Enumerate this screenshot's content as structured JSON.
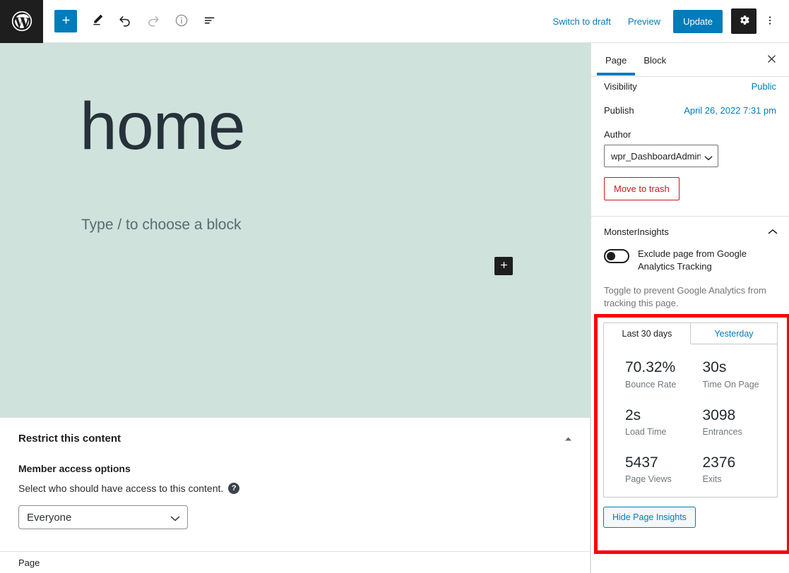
{
  "toolbar": {
    "logo_icon": "wordpress-logo-icon",
    "add_block_label": "+",
    "add_block_icon": "plus-icon",
    "edit_icon": "pencil-icon",
    "undo_icon": "undo-arrow-icon",
    "redo_icon": "redo-arrow-icon",
    "details_icon": "info-circle-icon",
    "list_view_icon": "list-view-icon",
    "switch_to_draft_label": "Switch to draft",
    "preview_label": "Preview",
    "update_label": "Update",
    "settings_icon": "gear-icon",
    "more_options_icon": "three-dots-vertical-icon",
    "accent_color": "#007cba",
    "dark_color": "#1e1e1e"
  },
  "canvas": {
    "post_title": "home",
    "block_placeholder": "Type / to choose a block",
    "inline_adder_label": "+",
    "inline_adder_icon": "plus-icon",
    "background_color": "#cfe2dc"
  },
  "meta_panel": {
    "title": "Restrict this content",
    "collapse_icon": "triangle-up-icon",
    "subtitle": "Member access options",
    "description": "Select who should have access to this content.",
    "help_icon": "question-mark-icon",
    "help_label": "?",
    "access_value": "Everyone",
    "access_options": [
      "Everyone"
    ],
    "select_chevron_icon": "chevron-down-icon"
  },
  "statusbar": {
    "breadcrumb": "Page"
  },
  "sidebar": {
    "tabs": [
      {
        "label": "Page",
        "active": true
      },
      {
        "label": "Block",
        "active": false
      }
    ],
    "close_icon": "close-icon",
    "status_rows": [
      {
        "label": "Visibility",
        "value": "Public"
      },
      {
        "label": "Publish",
        "value": "April 26, 2022 7:31 pm"
      }
    ],
    "author_label": "Author",
    "author_value": "wpr_DashboardAdmin",
    "author_options": [
      "wpr_DashboardAdmin"
    ],
    "author_chevron_icon": "chevron-down-icon",
    "trash_label": "Move to trash",
    "trash_color": "#cc1818",
    "monsterinsights": {
      "panel_title": "MonsterInsights",
      "collapse_icon": "chevron-up-icon",
      "toggle_label": "Exclude page from Google Analytics Tracking",
      "toggle_state": "off",
      "hint": "Toggle to prevent Google Analytics from tracking this page.",
      "insights": {
        "tabs": [
          {
            "label": "Last 30 days",
            "active": true
          },
          {
            "label": "Yesterday",
            "active": false
          }
        ],
        "stats": [
          {
            "value": "70.32%",
            "label": "Bounce Rate"
          },
          {
            "value": "30s",
            "label": "Time On Page"
          },
          {
            "value": "2s",
            "label": "Load Time"
          },
          {
            "value": "3098",
            "label": "Entrances"
          },
          {
            "value": "5437",
            "label": "Page Views"
          },
          {
            "value": "2376",
            "label": "Exits"
          }
        ],
        "hide_button_label": "Hide Page Insights"
      }
    },
    "highlight_color": "#ff0000"
  }
}
